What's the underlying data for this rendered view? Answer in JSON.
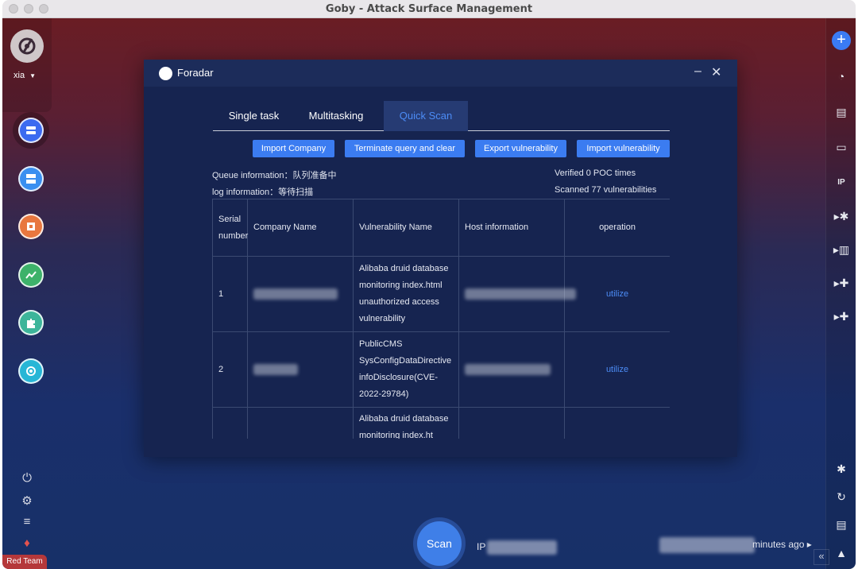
{
  "window": {
    "title": "Goby - Attack Surface Management"
  },
  "sidebar": {
    "user": "xia",
    "badge": "Red Team"
  },
  "modal": {
    "title": "Foradar",
    "tabs": [
      {
        "label": "Single task"
      },
      {
        "label": "Multitasking"
      },
      {
        "label": "Quick Scan"
      }
    ],
    "buttons": {
      "import_company": "Import Company",
      "terminate": "Terminate query and clear",
      "export": "Export vulnerability",
      "import_vuln": "Import vulnerability"
    },
    "info": {
      "queue": "Queue information：队列准备中",
      "log": "log information：等待扫描",
      "verified": "Verified 0 POC times",
      "scanned": "Scanned 77 vulnerabilities"
    },
    "table": {
      "headers": {
        "serial": "Serial number",
        "company": "Company Name",
        "vuln": "Vulnerability Name",
        "host": "Host information",
        "operation": "operation"
      },
      "rows": [
        {
          "num": "1",
          "vuln": "Alibaba druid database monitoring index.html unauthorized access vulnerability",
          "op": "utilize"
        },
        {
          "num": "2",
          "vuln": "PublicCMS SysConfigDataDirective infoDisclosure(CVE-2022-29784)",
          "op": "utilize"
        },
        {
          "num": "",
          "vuln": "Alibaba druid database monitoring index.ht",
          "op": ""
        }
      ]
    }
  },
  "scanbar": {
    "scan_label": "Scan",
    "ip_label": "IP",
    "time_text": "minutes ago"
  }
}
